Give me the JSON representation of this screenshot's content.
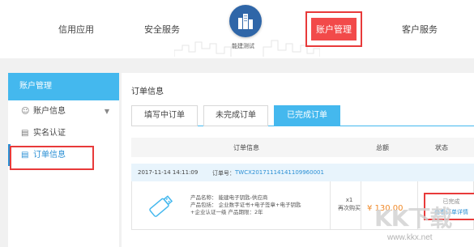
{
  "topnav": {
    "items": [
      "信用应用",
      "安全服务",
      "账户管理",
      "客户服务"
    ],
    "logo_text": "能建测试"
  },
  "sidebar": {
    "header": "账户管理",
    "items": [
      {
        "label": "账户信息",
        "icon": "user-icon"
      },
      {
        "label": "实名认证",
        "icon": "id-card-icon"
      },
      {
        "label": "订单信息",
        "icon": "list-icon"
      }
    ]
  },
  "main": {
    "title": "订单信息",
    "tabs": [
      "填写中订单",
      "未完成订单",
      "已完成订单"
    ],
    "table": {
      "headers": [
        "订单信息",
        "总额",
        "状态"
      ],
      "order": {
        "datetime": "2017-11-14 14:11:09",
        "number_label": "订单号：",
        "number": "TWCX20171114141109960001",
        "product_name": "产品名称：  能建电子钥匙-供应商",
        "product_includes": "产品包括：  企业数字证书+电子签章+电子钥匙",
        "product_extra": "+企业认证一级   产品期限：2年",
        "qty": "x1",
        "qty_note": "再次购买",
        "price": "¥ 130.00",
        "status": "已完成",
        "status_detail": "查看订单详情"
      }
    }
  },
  "colors": {
    "accent": "#44b8ee",
    "highlight": "#e83a3a",
    "nav_active": "#f24a4a",
    "price": "#f08a2a",
    "link": "#2a8fd4"
  },
  "watermark": {
    "logo": "KK下载",
    "url": "www.kkx.net"
  }
}
